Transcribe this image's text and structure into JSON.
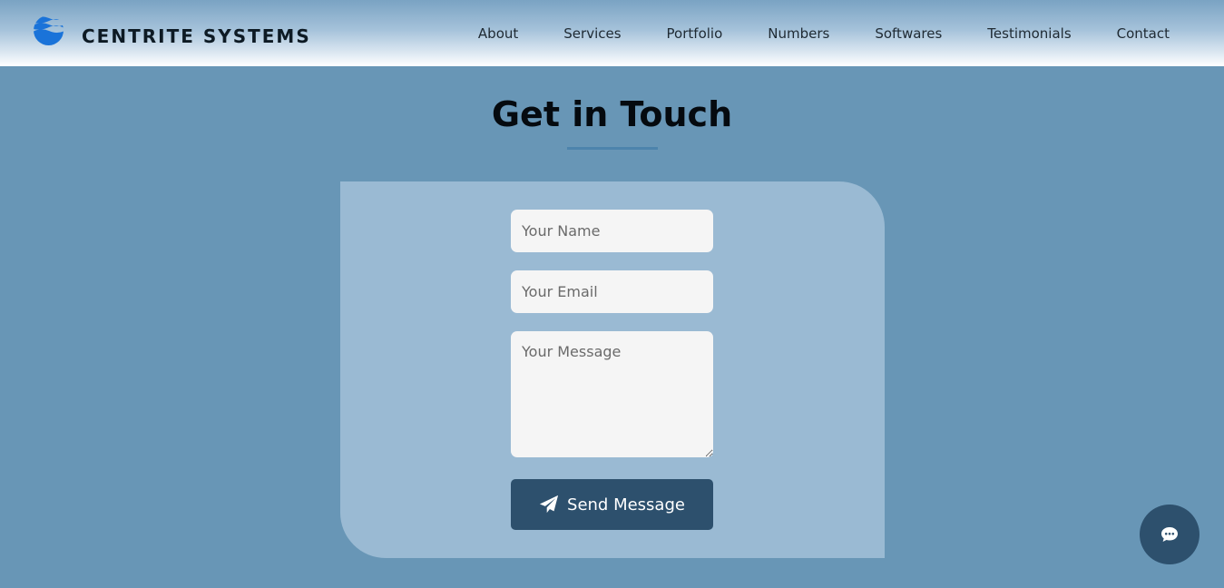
{
  "brand": {
    "name": "CENTRITE SYSTEMS",
    "logo_icon": "wave-globe-icon",
    "logo_color": "#1a73d9"
  },
  "nav": {
    "items": [
      {
        "label": "About"
      },
      {
        "label": "Services"
      },
      {
        "label": "Portfolio"
      },
      {
        "label": "Numbers"
      },
      {
        "label": "Softwares"
      },
      {
        "label": "Testimonials"
      },
      {
        "label": "Contact"
      }
    ]
  },
  "contact": {
    "title": "Get in Touch",
    "name_placeholder": "Your Name",
    "email_placeholder": "Your Email",
    "message_placeholder": "Your Message",
    "send_label": "Send Message",
    "send_icon": "paper-plane-icon"
  },
  "chat": {
    "icon": "chat-bubble-icon"
  },
  "colors": {
    "page_background": "#6896b6",
    "card_background": "#9abad3",
    "button_background": "#2d506d",
    "accent_underline": "#4d84ac"
  }
}
